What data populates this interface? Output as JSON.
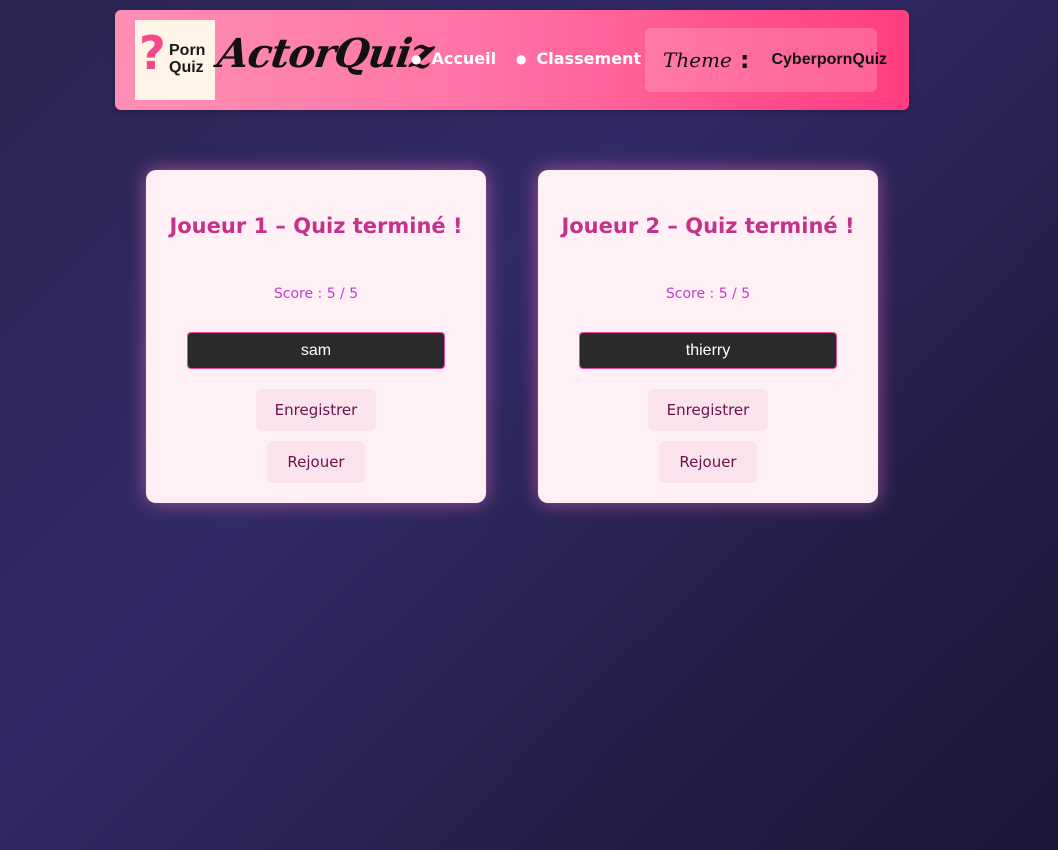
{
  "header": {
    "logo": {
      "mark": "?",
      "line1": "Porn",
      "line2": "Quiz"
    },
    "brand_title": "ActorQuiz",
    "nav": [
      {
        "label": "Accueil"
      },
      {
        "label": "Classement"
      }
    ],
    "theme": {
      "label": "Theme",
      "colon": ":",
      "value": "CyberpornQuiz"
    }
  },
  "players": [
    {
      "title": "Joueur 1 – Quiz terminé !",
      "score": "Score : 5 / 5",
      "name_value": "sam",
      "save_label": "Enregistrer",
      "replay_label": "Rejouer"
    },
    {
      "title": "Joueur 2 – Quiz terminé !",
      "score": "Score : 5 / 5",
      "name_value": "thierry",
      "save_label": "Enregistrer",
      "replay_label": "Rejouer"
    }
  ],
  "colors": {
    "header_gradient_start": "#ff8fb4",
    "header_gradient_end": "#ff3d80",
    "card_background": "#fff0f6",
    "card_title": "#c6318a",
    "score_text": "#c23ad2",
    "button_background": "#fbe3ee",
    "button_text": "#6c1246",
    "input_background": "#2a2a2a",
    "input_border": "#e84ca0"
  }
}
